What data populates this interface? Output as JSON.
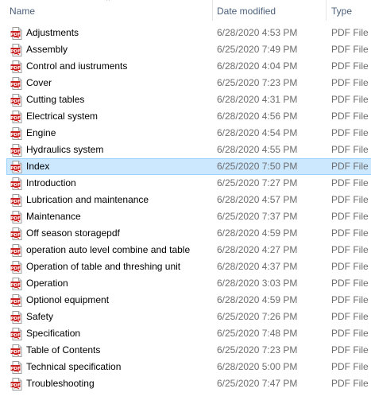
{
  "columns": {
    "name": "Name",
    "date_modified": "Date modified",
    "type": "Type"
  },
  "sort": {
    "column": "name",
    "direction": "ascending"
  },
  "colors": {
    "selection": "#cce8ff",
    "selection_border": "#99d1ff",
    "header_text": "#4c607a",
    "secondary_text": "#6d6d6d",
    "pdf_icon_red": "#c8201e"
  },
  "icon": "pdf-file-icon",
  "files": [
    {
      "name": "Adjustments",
      "date": "6/28/2020 4:53 PM",
      "type": "PDF File",
      "selected": false
    },
    {
      "name": "Assembly",
      "date": "6/25/2020 7:49 PM",
      "type": "PDF File",
      "selected": false
    },
    {
      "name": "Control and iustruments",
      "date": "6/28/2020 4:04 PM",
      "type": "PDF File",
      "selected": false
    },
    {
      "name": "Cover",
      "date": "6/25/2020 7:23 PM",
      "type": "PDF File",
      "selected": false
    },
    {
      "name": "Cutting tables",
      "date": "6/28/2020 4:31 PM",
      "type": "PDF File",
      "selected": false
    },
    {
      "name": "Electrical system",
      "date": "6/28/2020 4:56 PM",
      "type": "PDF File",
      "selected": false
    },
    {
      "name": "Engine",
      "date": "6/28/2020 4:54 PM",
      "type": "PDF File",
      "selected": false
    },
    {
      "name": "Hydraulics system",
      "date": "6/28/2020 4:55 PM",
      "type": "PDF File",
      "selected": false
    },
    {
      "name": "Index",
      "date": "6/25/2020 7:50 PM",
      "type": "PDF File",
      "selected": true
    },
    {
      "name": "Introduction",
      "date": "6/25/2020 7:27 PM",
      "type": "PDF File",
      "selected": false
    },
    {
      "name": "Lubrication and maintenance",
      "date": "6/28/2020 4:57 PM",
      "type": "PDF File",
      "selected": false
    },
    {
      "name": "Maintenance",
      "date": "6/25/2020 7:37 PM",
      "type": "PDF File",
      "selected": false
    },
    {
      "name": "Off season storagepdf",
      "date": "6/28/2020 4:59 PM",
      "type": "PDF File",
      "selected": false
    },
    {
      "name": "operation auto level combine and table",
      "date": "6/28/2020 4:27 PM",
      "type": "PDF File",
      "selected": false
    },
    {
      "name": "Operation of table and threshing unit",
      "date": "6/28/2020 4:37 PM",
      "type": "PDF File",
      "selected": false
    },
    {
      "name": "Operation",
      "date": "6/28/2020 3:03 PM",
      "type": "PDF File",
      "selected": false
    },
    {
      "name": "Optionol equipment",
      "date": "6/28/2020 4:59 PM",
      "type": "PDF File",
      "selected": false
    },
    {
      "name": "Safety",
      "date": "6/25/2020 7:26 PM",
      "type": "PDF File",
      "selected": false
    },
    {
      "name": "Specification",
      "date": "6/25/2020 7:48 PM",
      "type": "PDF File",
      "selected": false
    },
    {
      "name": "Table of Contents",
      "date": "6/25/2020 7:23 PM",
      "type": "PDF File",
      "selected": false
    },
    {
      "name": "Technical specification",
      "date": "6/28/2020 5:00 PM",
      "type": "PDF File",
      "selected": false
    },
    {
      "name": "Troubleshooting",
      "date": "6/25/2020 7:47 PM",
      "type": "PDF File",
      "selected": false
    }
  ]
}
